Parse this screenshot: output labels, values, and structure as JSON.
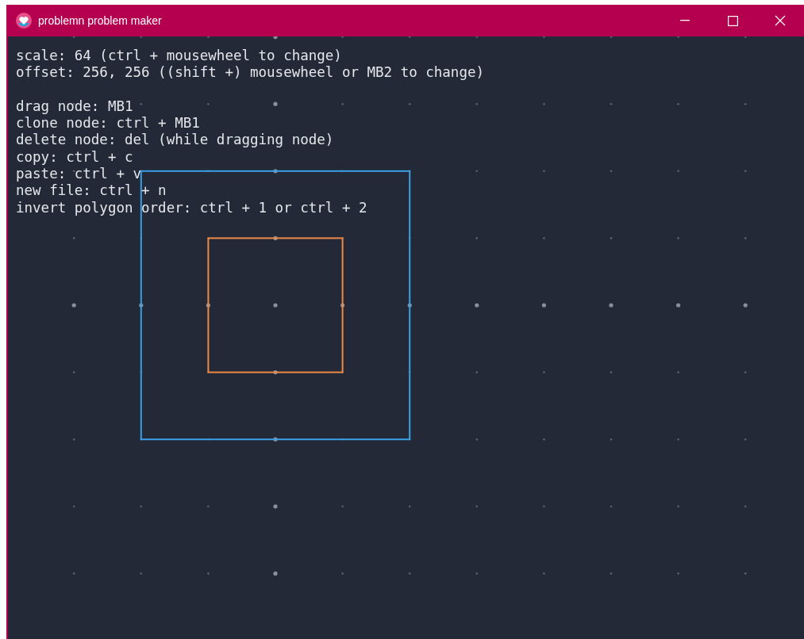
{
  "window": {
    "title": "problemn problem maker"
  },
  "help_groups": [
    [
      "scale: 64 (ctrl + mousewheel to change)",
      "offset: 256, 256 ((shift +) mousewheel or MB2 to change)"
    ],
    [
      "drag node: MB1",
      "clone node: ctrl + MB1",
      "delete node: del (while dragging node)",
      "copy: ctrl + c",
      "paste: ctrl + v",
      "new file: ctrl + n",
      "invert polygon order: ctrl + 1 or ctrl + 2"
    ]
  ],
  "polygons": [
    {
      "color": "#3b9ee6"
    },
    {
      "color": "#ee8a45"
    }
  ]
}
